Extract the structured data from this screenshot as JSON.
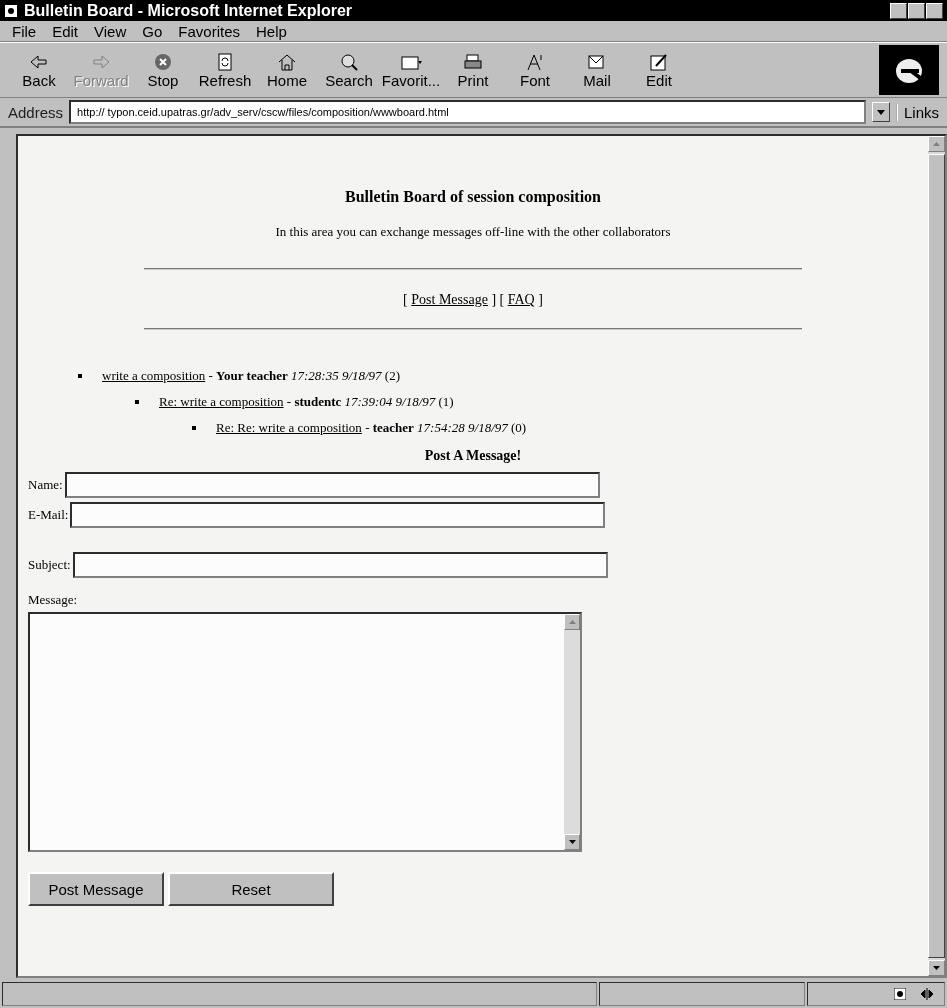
{
  "window": {
    "title": "Bulletin Board - Microsoft Internet Explorer"
  },
  "menu": [
    "File",
    "Edit",
    "View",
    "Go",
    "Favorites",
    "Help"
  ],
  "toolbar": [
    {
      "kind": "back",
      "label": "Back",
      "disabled": false
    },
    {
      "kind": "forward",
      "label": "Forward",
      "disabled": true
    },
    {
      "kind": "stop",
      "label": "Stop",
      "disabled": false
    },
    {
      "kind": "refresh",
      "label": "Refresh",
      "disabled": false
    },
    {
      "kind": "home",
      "label": "Home",
      "disabled": false
    },
    {
      "kind": "search",
      "label": "Search",
      "disabled": false
    },
    {
      "kind": "favorites",
      "label": "Favorit...",
      "disabled": false
    },
    {
      "kind": "print",
      "label": "Print",
      "disabled": false
    },
    {
      "kind": "font",
      "label": "Font",
      "disabled": false
    },
    {
      "kind": "mail",
      "label": "Mail",
      "disabled": false
    },
    {
      "kind": "edit",
      "label": "Edit",
      "disabled": false
    }
  ],
  "address_bar": {
    "label": "Address",
    "url": "http://  typon.ceid.upatras.gr/adv_serv/cscw/files/composition/wwwboard.html",
    "links": "Links"
  },
  "page": {
    "heading": "Bulletin Board of session composition",
    "intro": "In this area you can exchange messages off-line with the other collaborators",
    "nav": [
      {
        "open": "[ ",
        "link": "Post Message",
        "close": " ]"
      },
      {
        "open": " [ ",
        "link": "FAQ",
        "close": " ]"
      }
    ],
    "threads": [
      {
        "subject": "write a composition",
        "separator": "-",
        "author": "Your teacher",
        "time": "17:28:35 9/18/97",
        "count": "(2)",
        "children": [
          {
            "subject": "Re: write a composition",
            "separator": "-",
            "author": "studentc",
            "time": "17:39:04 9/18/97",
            "count": "(1)",
            "children": [
              {
                "subject": "Re: Re: write a composition",
                "separator": "-",
                "author": "teacher",
                "time": "17:54:28 9/18/97",
                "count": "(0)"
              }
            ]
          }
        ]
      }
    ],
    "form": {
      "title": "Post A Message!",
      "fields": [
        {
          "label": "Name:"
        },
        {
          "label": "E-Mail:"
        },
        {
          "label": "Subject:"
        }
      ],
      "message_label": "Message:",
      "buttons": [
        "Post Message",
        "Reset"
      ]
    }
  }
}
